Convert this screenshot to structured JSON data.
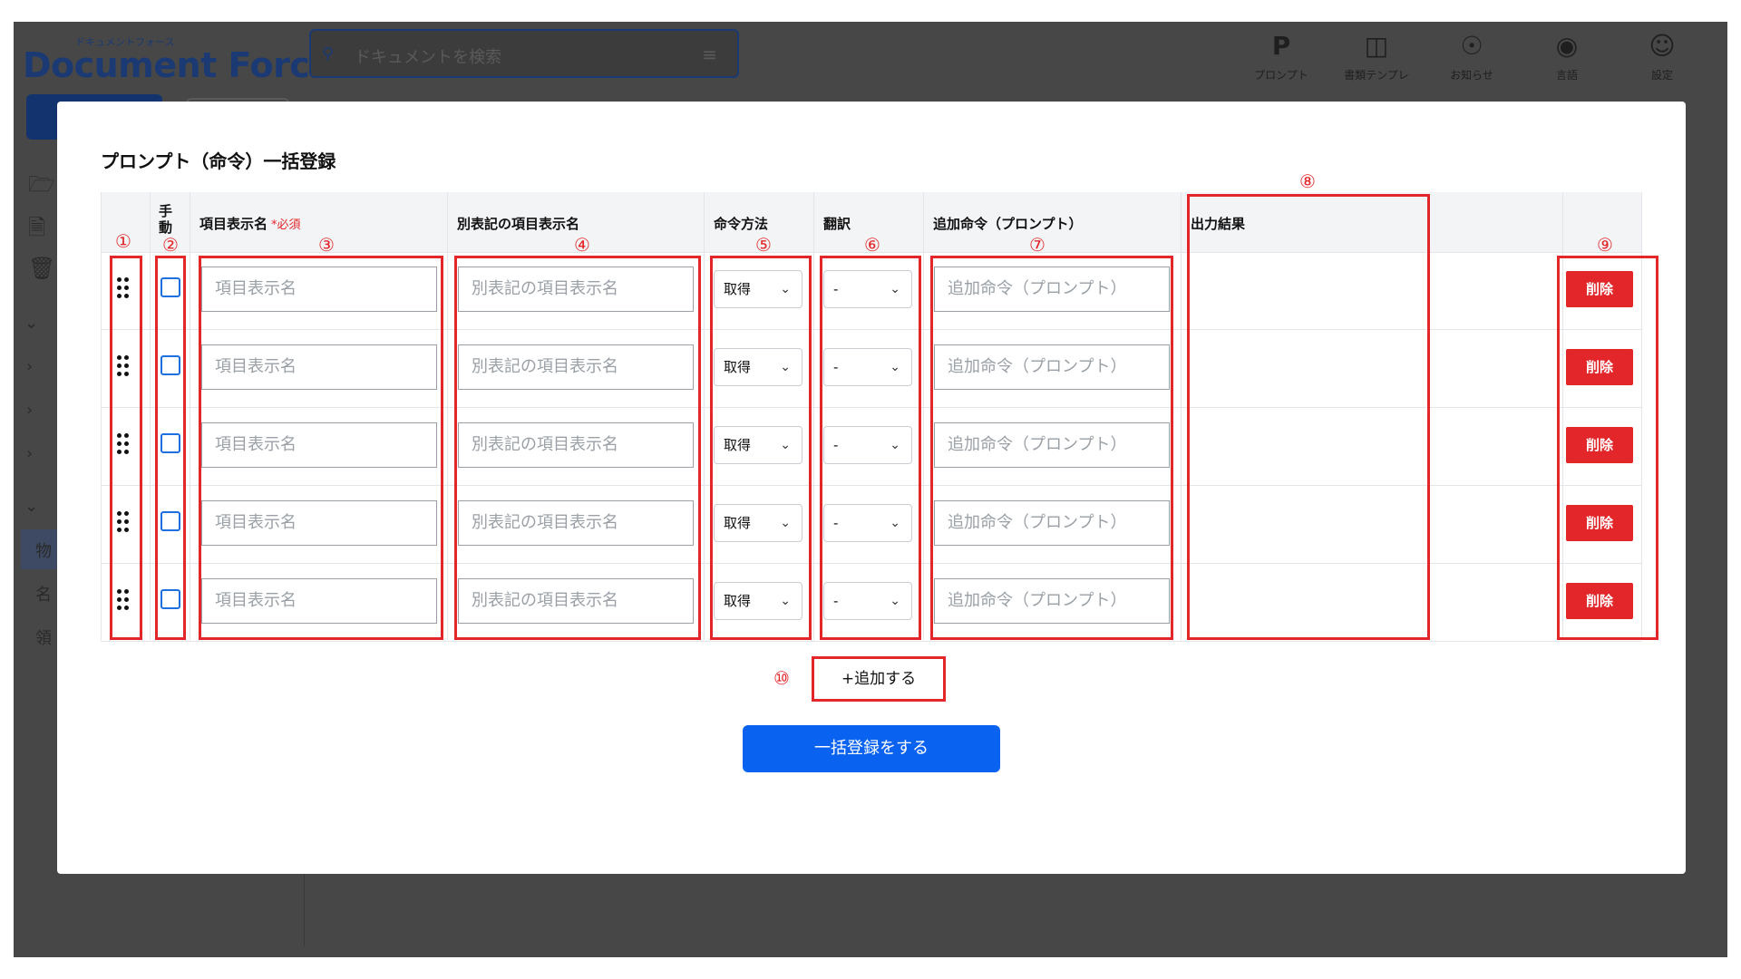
{
  "app": {
    "logo_kana": "ドキュメントフォース",
    "logo_text": "Document Force",
    "search_placeholder": "ドキュメントを検索",
    "nav": [
      {
        "label": "プロンプト",
        "icon": "prompt-icon"
      },
      {
        "label": "書類テンプレ",
        "icon": "template-icon"
      },
      {
        "label": "お知らせ",
        "icon": "bell-icon"
      },
      {
        "label": "言語",
        "icon": "globe-icon"
      },
      {
        "label": "設定",
        "icon": "user-settings-icon"
      }
    ],
    "sidebar_partial": [
      "物",
      "名",
      "領"
    ]
  },
  "modal": {
    "title": "プロンプト（命令）一括登録",
    "headers": {
      "manual": "手動",
      "item_name": "項目表示名",
      "required": "*必須",
      "alt_name": "別表記の項目表示名",
      "method": "命令方法",
      "translation": "翻訳",
      "extra_prompt": "追加命令（プロンプト）",
      "output": "出力結果"
    },
    "rows": [
      {
        "item_placeholder": "項目表示名",
        "alt_placeholder": "別表記の項目表示名",
        "method": "取得",
        "translation": "-",
        "prompt_placeholder": "追加命令（プロンプト）",
        "delete": "削除"
      },
      {
        "item_placeholder": "項目表示名",
        "alt_placeholder": "別表記の項目表示名",
        "method": "取得",
        "translation": "-",
        "prompt_placeholder": "追加命令（プロンプト）",
        "delete": "削除"
      },
      {
        "item_placeholder": "項目表示名",
        "alt_placeholder": "別表記の項目表示名",
        "method": "取得",
        "translation": "-",
        "prompt_placeholder": "追加命令（プロンプト）",
        "delete": "削除"
      },
      {
        "item_placeholder": "項目表示名",
        "alt_placeholder": "別表記の項目表示名",
        "method": "取得",
        "translation": "-",
        "prompt_placeholder": "追加命令（プロンプト）",
        "delete": "削除"
      },
      {
        "item_placeholder": "項目表示名",
        "alt_placeholder": "別表記の項目表示名",
        "method": "取得",
        "translation": "-",
        "prompt_placeholder": "追加命令（プロンプト）",
        "delete": "削除"
      }
    ],
    "add_label": "+追加する",
    "submit_label": "一括登録をする",
    "annotations": [
      "①",
      "②",
      "③",
      "④",
      "⑤",
      "⑥",
      "⑦",
      "⑧",
      "⑨",
      "⑩"
    ]
  },
  "colors": {
    "accent": "#0a63f0",
    "danger": "#e2262a",
    "annotation": "#e2262a",
    "brand": "#1b3a73"
  }
}
